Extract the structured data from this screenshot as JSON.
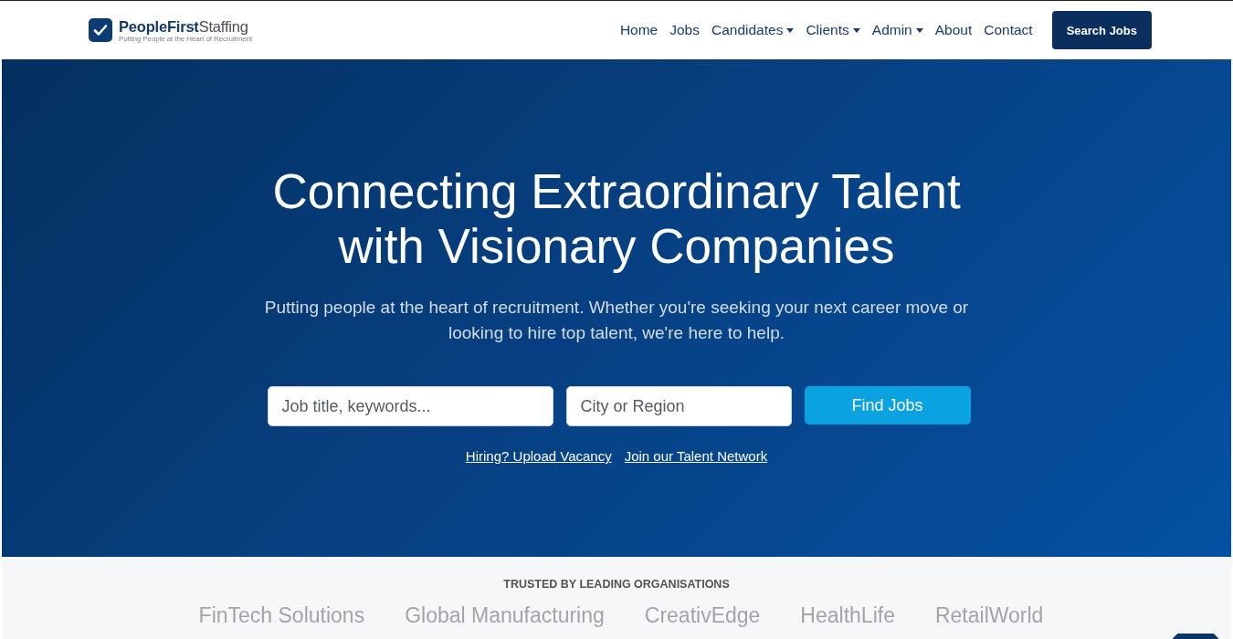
{
  "header": {
    "logo": {
      "brand_bold": "PeopleFirst",
      "brand_light": "Staffing",
      "tagline": "Putting People at the Heart of Recruitment"
    },
    "nav": [
      {
        "label": "Home",
        "has_menu": false
      },
      {
        "label": "Jobs",
        "has_menu": false
      },
      {
        "label": "Candidates",
        "has_menu": true
      },
      {
        "label": "Clients",
        "has_menu": true
      },
      {
        "label": "Admin",
        "has_menu": true
      },
      {
        "label": "About",
        "has_menu": false
      },
      {
        "label": "Contact",
        "has_menu": false
      }
    ],
    "cta_button": "Search Jobs"
  },
  "hero": {
    "heading": "Connecting Extraordinary Talent with Visionary Companies",
    "subtitle": "Putting people at the heart of recruitment. Whether you're seeking your next career move or looking to hire top talent, we're here to help.",
    "search": {
      "keywords_placeholder": "Job title, keywords...",
      "location_placeholder": "City or Region",
      "button": "Find Jobs"
    },
    "links": [
      "Hiring? Upload Vacancy",
      "Join our Talent Network"
    ]
  },
  "trusted": {
    "label": "TRUSTED BY LEADING ORGANISATIONS",
    "logos": [
      "FinTech Solutions",
      "Global Manufacturing",
      "CreativEdge",
      "HealthLife",
      "RetailWorld"
    ]
  }
}
